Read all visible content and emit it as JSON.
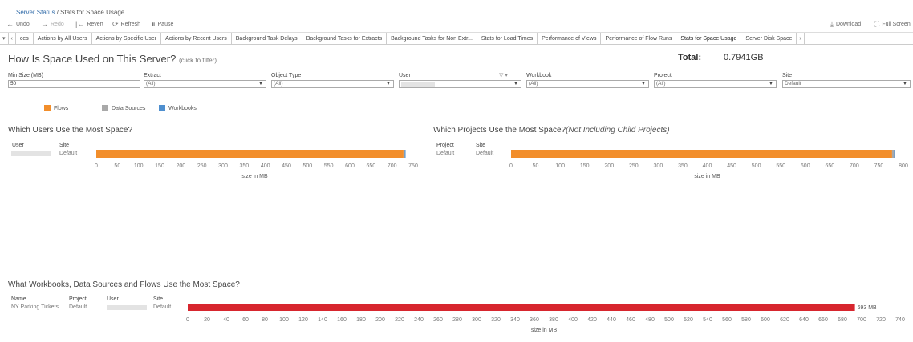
{
  "breadcrumb": {
    "parent": "Server Status",
    "separator": "/",
    "current": "Stats for Space Usage"
  },
  "toolbar": {
    "undo": "Undo",
    "redo": "Redo",
    "revert": "Revert",
    "refresh": "Refresh",
    "pause": "Pause",
    "download": "Download",
    "fullscreen": "Full Screen"
  },
  "tabs": {
    "items": [
      "ces",
      "Actions by All Users",
      "Actions by Specific User",
      "Actions by Recent Users",
      "Background Task Delays",
      "Background Tasks for Extracts",
      "Background Tasks for Non Extr...",
      "Stats for Load Times",
      "Performance of Views",
      "Performance of Flow Runs",
      "Stats for Space Usage",
      "Server Disk Space"
    ],
    "active": "Stats for Space Usage"
  },
  "header": {
    "title": "How Is Space Used on This Server?",
    "hint": "(click to filter)",
    "total_label": "Total:",
    "total_value": "0.7941GB"
  },
  "filters": {
    "min_size": {
      "label": "Min Size (MB)",
      "value": "50"
    },
    "extract": {
      "label": "Extract",
      "value": "(All)"
    },
    "object_type": {
      "label": "Object Type",
      "value": "(All)"
    },
    "user": {
      "label": "User",
      "value": ""
    },
    "workbook": {
      "label": "Workbook",
      "value": "(All)"
    },
    "project": {
      "label": "Project",
      "value": "(All)"
    },
    "site": {
      "label": "Site",
      "value": "Default"
    }
  },
  "legend": {
    "items": [
      {
        "label": "Flows",
        "color": "#f28e2b"
      },
      {
        "label": "Data Sources",
        "color": "#a9a9a9"
      },
      {
        "label": "Workbooks",
        "color": "#4e8fcf"
      }
    ]
  },
  "users_section": {
    "title": "Which Users Use the Most Space?",
    "col_user": "User",
    "col_site": "Site",
    "row_site": "Default"
  },
  "projects_section": {
    "title": "Which Projects Use the Most Space?",
    "title_note": "(Not Including Child Projects)",
    "col_project": "Project",
    "col_site": "Site",
    "row_project": "Default",
    "row_site": "Default"
  },
  "workbooks_section": {
    "title": "What Workbooks, Data Sources and Flows Use the Most Space?",
    "col_name": "Name",
    "col_project": "Project",
    "col_user": "User",
    "col_site": "Site",
    "row_name": "NY Parking Tickets",
    "row_project": "Default",
    "row_site": "Default"
  },
  "chart_data": [
    {
      "type": "bar",
      "stacked": true,
      "orientation": "horizontal",
      "categories": [
        ""
      ],
      "series": [
        {
          "name": "Flows",
          "values": [
            727
          ]
        },
        {
          "name": "Data Sources",
          "values": [
            3
          ]
        },
        {
          "name": "Workbooks",
          "values": [
            2
          ]
        }
      ],
      "xlabel": "size in MB",
      "xlim": [
        0,
        750
      ],
      "ticks": [
        0,
        50,
        100,
        150,
        200,
        250,
        300,
        350,
        400,
        450,
        500,
        550,
        600,
        650,
        700,
        750
      ]
    },
    {
      "type": "bar",
      "stacked": true,
      "orientation": "horizontal",
      "categories": [
        "Default"
      ],
      "series": [
        {
          "name": "Flows",
          "values": [
            777
          ]
        },
        {
          "name": "Data Sources",
          "values": [
            4
          ]
        },
        {
          "name": "Workbooks",
          "values": [
            2
          ]
        }
      ],
      "xlabel": "size in MB",
      "xlim": [
        0,
        800
      ],
      "ticks": [
        0,
        50,
        100,
        150,
        200,
        250,
        300,
        350,
        400,
        450,
        500,
        550,
        600,
        650,
        700,
        750,
        800
      ]
    },
    {
      "type": "bar",
      "orientation": "horizontal",
      "categories": [
        "NY Parking Tickets"
      ],
      "series": [
        {
          "values": [
            693
          ],
          "color": "#d7262e"
        }
      ],
      "data_labels": [
        "693 MB"
      ],
      "xlabel": "size in MB",
      "xlim": [
        0,
        740
      ],
      "ticks": [
        0,
        20,
        40,
        60,
        80,
        100,
        120,
        140,
        160,
        180,
        200,
        220,
        240,
        260,
        280,
        300,
        320,
        340,
        360,
        380,
        400,
        420,
        440,
        460,
        480,
        500,
        520,
        540,
        560,
        580,
        600,
        620,
        640,
        660,
        680,
        700,
        720,
        740
      ]
    }
  ]
}
